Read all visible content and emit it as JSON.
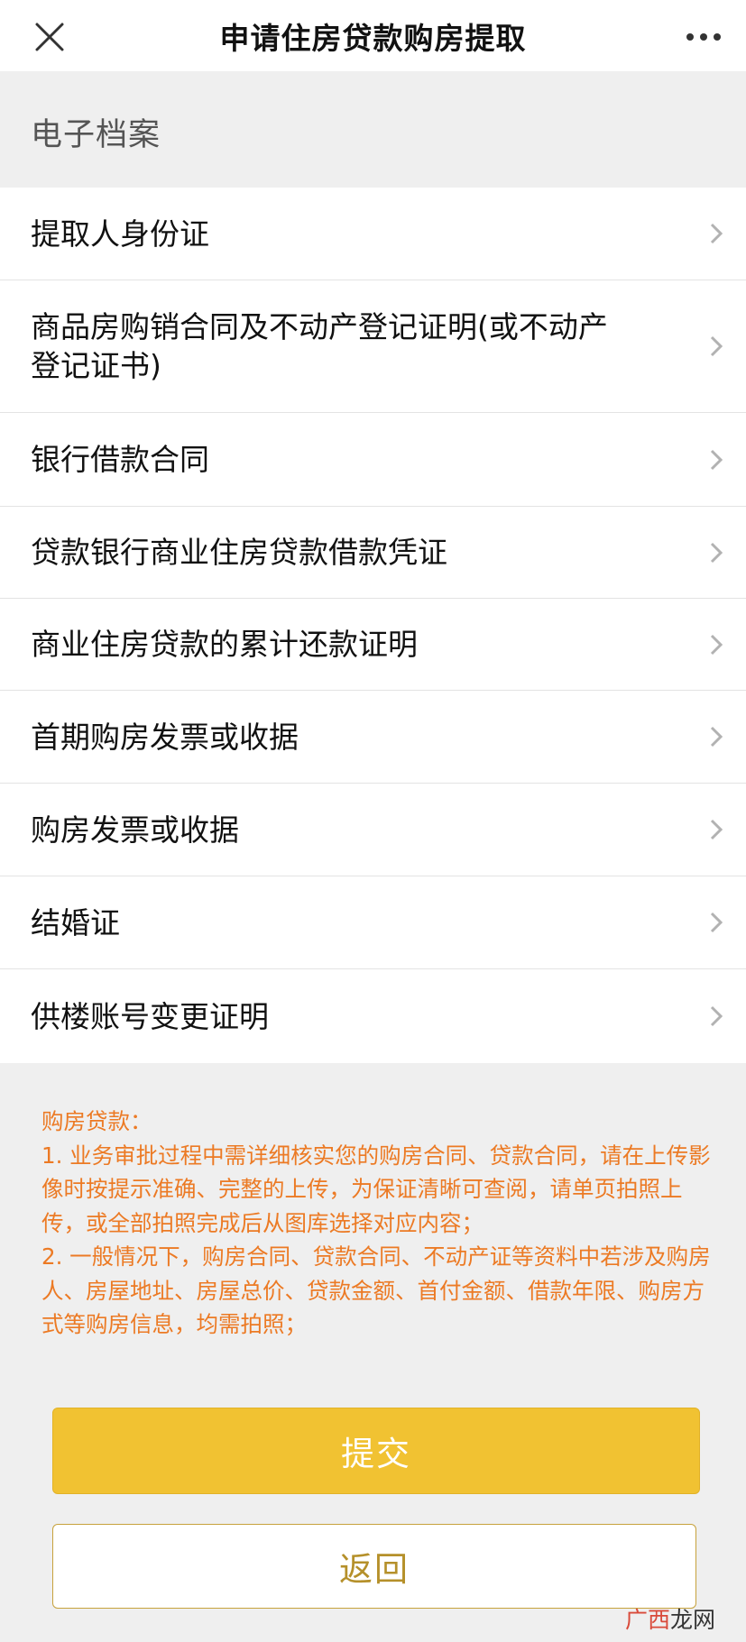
{
  "header": {
    "title": "申请住房贷款购房提取",
    "close_icon": "close-icon",
    "more_icon": "more-horizontal-icon"
  },
  "section": {
    "title": "电子档案"
  },
  "items": [
    {
      "label": "提取人身份证"
    },
    {
      "label": "商品房购销合同及不动产登记证明(或不动产登记证书)"
    },
    {
      "label": "银行借款合同"
    },
    {
      "label": "贷款银行商业住房贷款借款凭证"
    },
    {
      "label": "商业住房贷款的累计还款证明"
    },
    {
      "label": "首期购房发票或收据"
    },
    {
      "label": "购房发票或收据"
    },
    {
      "label": "结婚证"
    },
    {
      "label": "供楼账号变更证明"
    }
  ],
  "notice": {
    "lines": [
      "购房贷款：",
      "1. 业务审批过程中需详细核实您的购房合同、贷款合同，请在上传影",
      "像时按提示准确、完整的上传，为保证清晰可查阅，请单页拍照上",
      "传，或全部拍照完成后从图库选择对应内容；",
      "2. 一般情况下，购房合同、贷款合同、不动产证等资料中若涉及购房",
      "人、房屋地址、房屋总价、贷款金额、首付金额、借款年限、购房方",
      "式等购房信息，均需拍照；"
    ]
  },
  "buttons": {
    "submit": "提交",
    "back": "返回"
  },
  "watermark": {
    "accent": "广西",
    "rest": "龙网"
  },
  "colors": {
    "accent": "#f1c232",
    "notice": "#ec7a24",
    "back_text": "#b5902a"
  }
}
